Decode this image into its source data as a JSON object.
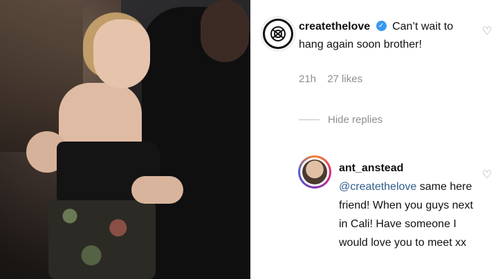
{
  "comments": {
    "main": {
      "username": "createthelove",
      "text": "Can’t wait to hang again soon brother!",
      "time": "21h",
      "likes": "27 likes",
      "verified_mark": "✓"
    },
    "hide_replies_label": "Hide replies",
    "reply": {
      "username": "ant_anstead",
      "mention": "@createthelove",
      "text": "same here friend! When you guys next in Cali! Have someone I would love you to meet xx"
    }
  },
  "icons": {
    "heart": "♡",
    "avatar_logo": "knot-logo"
  },
  "colors": {
    "muted": "#8e8e8e",
    "mention": "#2e5d8a",
    "verified": "#3897f0"
  }
}
